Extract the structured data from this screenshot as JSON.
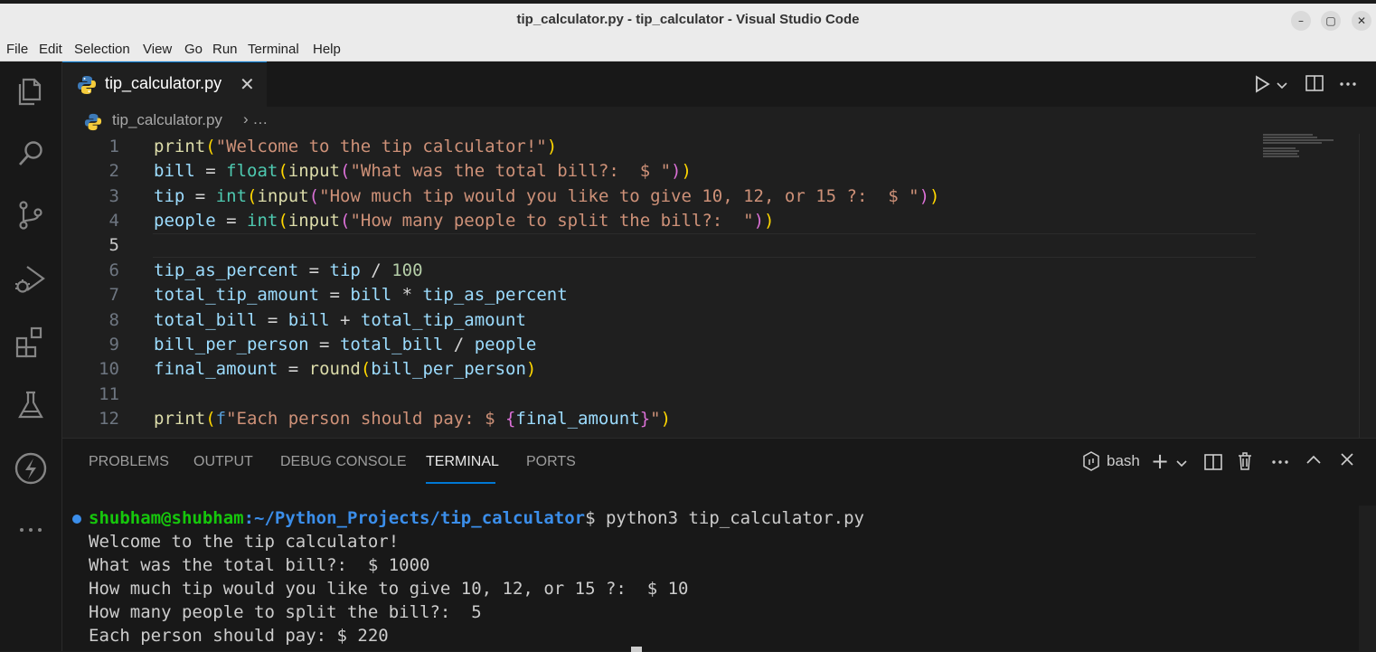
{
  "window": {
    "title": "tip_calculator.py - tip_calculator - Visual Studio Code"
  },
  "menu": [
    "File",
    "Edit",
    "Selection",
    "View",
    "Go",
    "Run",
    "Terminal",
    "Help"
  ],
  "activity_icons": [
    "explorer-icon",
    "search-icon",
    "source-control-icon",
    "run-debug-icon",
    "extensions-icon",
    "testing-icon",
    "lightning-icon",
    "more-icon"
  ],
  "tab": {
    "filename": "tip_calculator.py",
    "close": "✕"
  },
  "breadcrumb": {
    "file": "tip_calculator.py",
    "sep": "› …"
  },
  "editor": {
    "line_numbers": [
      "1",
      "2",
      "3",
      "4",
      "5",
      "6",
      "7",
      "8",
      "9",
      "10",
      "11",
      "12"
    ],
    "active_line": "5"
  },
  "panel": {
    "tabs": [
      "PROBLEMS",
      "OUTPUT",
      "DEBUG CONSOLE",
      "TERMINAL",
      "PORTS"
    ],
    "active_tab": "TERMINAL",
    "shell": "bash"
  },
  "terminal": {
    "prompt_user": "shubham@shubham",
    "prompt_path": ":~/Python_Projects/tip_calculator",
    "prompt_cmd": "$ python3 tip_calculator.py",
    "output": [
      "Welcome to the tip calculator!",
      "What was the total bill?:  $ 1000",
      "How much tip would you like to give 10, 12, or 15 ?:  $ 10",
      "How many people to split the bill?:  5",
      "Each person should pay: $ 220"
    ]
  }
}
